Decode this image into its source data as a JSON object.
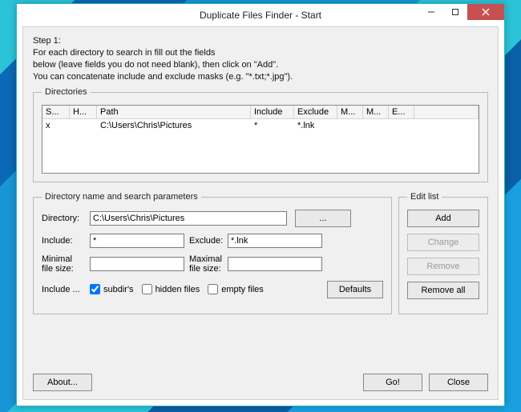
{
  "window": {
    "title": "Duplicate Files Finder - Start"
  },
  "instructions": {
    "line1": "Step 1:",
    "line2": "For each directory to search in fill out the fields",
    "line3": "below (leave fields you do not need blank), then click on \"Add\".",
    "line4": "You can concatenate include and exclude masks (e.g. \"*.txt;*.jpg\")."
  },
  "dir_group": {
    "legend": "Directories"
  },
  "listview": {
    "headers": [
      "S...",
      "H...",
      "Path",
      "Include",
      "Exclude",
      "M...",
      "M...",
      "E..."
    ],
    "rows": [
      {
        "s": "x",
        "h": "",
        "path": "C:\\Users\\Chris\\Pictures",
        "include": "*",
        "exclude": "*.lnk",
        "m1": "",
        "m2": "",
        "e": ""
      }
    ]
  },
  "params": {
    "legend": "Directory name and search parameters",
    "directory_label": "Directory:",
    "directory_value": "C:\\Users\\Chris\\Pictures",
    "browse_label": "...",
    "include_label": "Include:",
    "include_value": "*",
    "exclude_label": "Exclude:",
    "exclude_value": "*.lnk",
    "min_label": "Minimal\nfile size:",
    "min_value": "",
    "max_label": "Maximal\nfile size:",
    "max_value": "",
    "include_opts_label": "Include ...",
    "subdirs_label": "subdir's",
    "hidden_label": "hidden files",
    "empty_label": "empty files",
    "defaults_label": "Defaults"
  },
  "editlist": {
    "legend": "Edit list",
    "add": "Add",
    "change": "Change",
    "remove": "Remove",
    "remove_all": "Remove all"
  },
  "footer": {
    "about": "About...",
    "go": "Go!",
    "close": "Close"
  }
}
